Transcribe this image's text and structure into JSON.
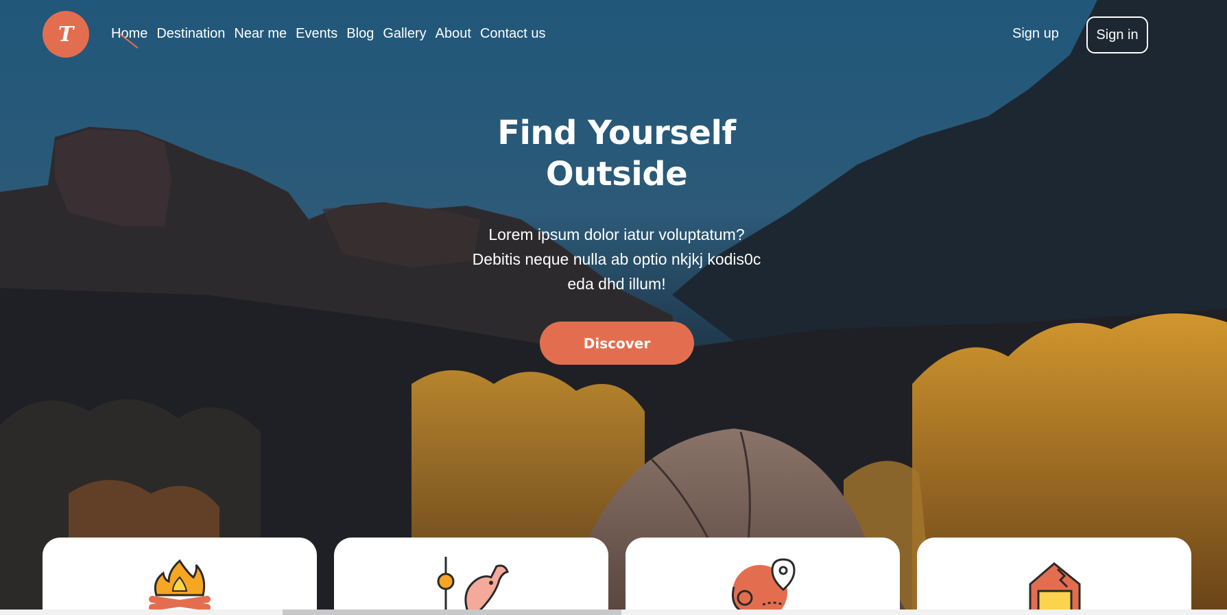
{
  "brand": {
    "logo_letter": "T",
    "accent_color": "#e36e4f"
  },
  "nav": {
    "items": [
      {
        "label": "Home",
        "active": true
      },
      {
        "label": "Destination"
      },
      {
        "label": "Near me"
      },
      {
        "label": "Events"
      },
      {
        "label": "Blog"
      },
      {
        "label": "Gallery"
      },
      {
        "label": "About"
      },
      {
        "label": "Contact us"
      }
    ],
    "sign_up": "Sign up",
    "sign_in": "Sign in"
  },
  "hero": {
    "title_line1": "Find Yourself",
    "title_line2": "Outside",
    "subtitle_line1": "Lorem ipsum dolor iatur voluptatum?",
    "subtitle_line2": "Debitis neque nulla ab optio nkjkj kodis0c",
    "subtitle_line3": "eda dhd illum!",
    "cta": "Discover"
  },
  "cards": [
    {
      "icon": "campfire-icon"
    },
    {
      "icon": "fishing-icon"
    },
    {
      "icon": "map-location-icon"
    },
    {
      "icon": "ticket-icon"
    }
  ]
}
